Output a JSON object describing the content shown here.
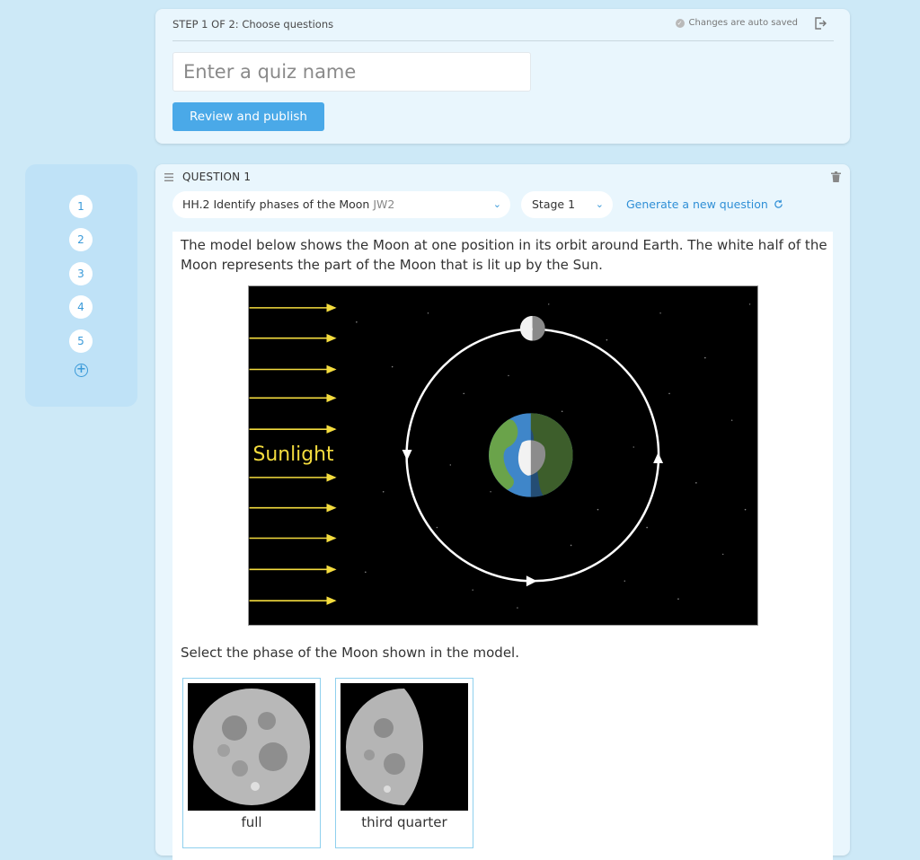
{
  "header": {
    "step_label": "STEP 1 OF 2: Choose questions",
    "autosave_text": "Changes are auto saved",
    "quiz_name_placeholder": "Enter a quiz name",
    "quiz_name_value": "",
    "publish_label": "Review and publish"
  },
  "nav": {
    "items": [
      "1",
      "2",
      "3",
      "4",
      "5"
    ],
    "add_icon": "plus-circle-icon"
  },
  "question": {
    "label": "QUESTION 1",
    "skill": "HH.2 Identify phases of the Moon",
    "skill_code": "JW2",
    "stage": "Stage 1",
    "generate_label": "Generate a new question",
    "prompt": "The model below shows the Moon at one position in its orbit around Earth. The white half of the Moon represents the part of the Moon that is lit up by the Sun.",
    "model_label": "Sunlight",
    "instruction": "Select the phase of the Moon shown in the model.",
    "choices": [
      "full",
      "third quarter"
    ]
  },
  "colors": {
    "page_bg": "#cde9f7",
    "card_bg": "#e9f6fd",
    "accent": "#4aa9e8",
    "sunlight": "#f4dc3e"
  }
}
